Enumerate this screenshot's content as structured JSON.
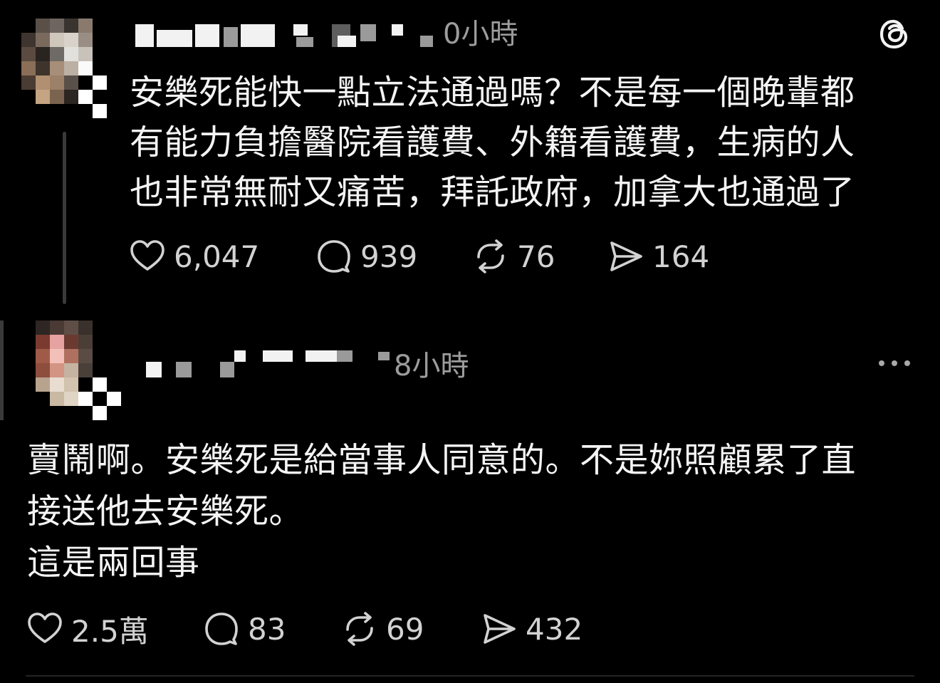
{
  "post": {
    "username": "",
    "timestamp": "0小時",
    "text_lines": [
      "安樂死能快一點立法通過嗎？不是每一個晚輩都",
      "有能力負擔醫院看護費、外籍看護費，生病的人",
      "也非常無耐又痛苦，拜託政府，加拿大也通過了"
    ],
    "likes": "6,047",
    "replies": "939",
    "reposts": "76",
    "shares": "164"
  },
  "reply": {
    "username": "",
    "timestamp": "8小時",
    "text_lines": [
      "賣鬧啊。安樂死是給當事人同意的。不是妳照顧累了直",
      "接送他去安樂死。",
      "這是兩回事"
    ],
    "likes": "2.5萬",
    "replies": "83",
    "reposts": "69",
    "shares": "432"
  },
  "icons": {
    "logo": "threads-logo-icon",
    "more": "more-options-icon",
    "like": "heart-icon",
    "reply": "comment-bubble-icon",
    "repost": "repost-icon",
    "share": "send-icon"
  },
  "colors": {
    "background": "#000000",
    "text": "#f4f4f4",
    "muted": "#9c9c9c",
    "thread_line": "#3a3a3a"
  }
}
